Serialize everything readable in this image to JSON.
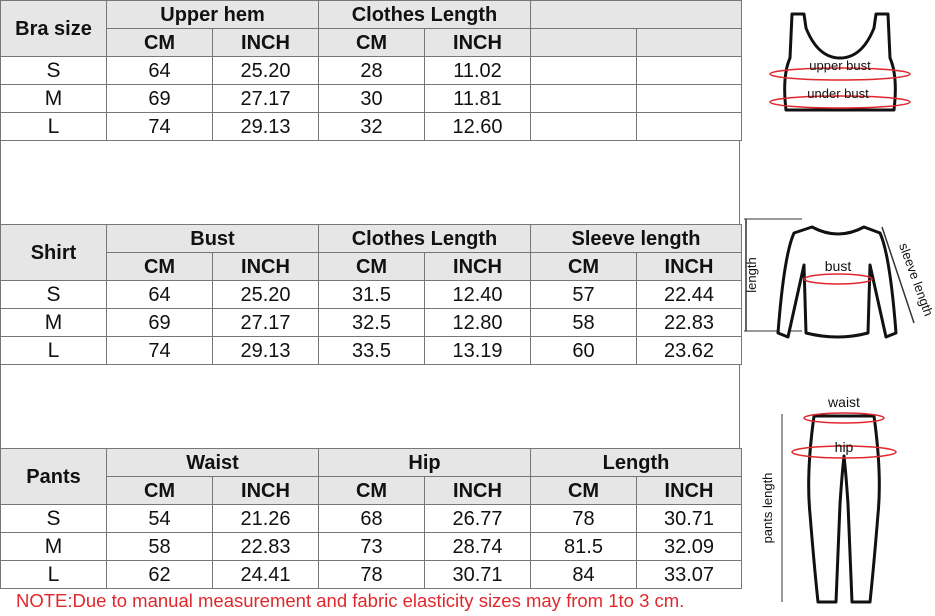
{
  "tables": [
    {
      "label": "Bra size",
      "groups": [
        "Upper hem",
        "Clothes Length",
        ""
      ],
      "units": [
        "CM",
        "INCH",
        "CM",
        "INCH",
        "",
        ""
      ],
      "rows": [
        [
          "S",
          "64",
          "25.20",
          "28",
          "11.02",
          "",
          ""
        ],
        [
          "M",
          "69",
          "27.17",
          "30",
          "11.81",
          "",
          ""
        ],
        [
          "L",
          "74",
          "29.13",
          "32",
          "12.60",
          "",
          ""
        ]
      ]
    },
    {
      "label": "Shirt",
      "groups": [
        "Bust",
        "Clothes Length",
        "Sleeve length"
      ],
      "units": [
        "CM",
        "INCH",
        "CM",
        "INCH",
        "CM",
        "INCH"
      ],
      "rows": [
        [
          "S",
          "64",
          "25.20",
          "31.5",
          "12.40",
          "57",
          "22.44"
        ],
        [
          "M",
          "69",
          "27.17",
          "32.5",
          "12.80",
          "58",
          "22.83"
        ],
        [
          "L",
          "74",
          "29.13",
          "33.5",
          "13.19",
          "60",
          "23.62"
        ]
      ]
    },
    {
      "label": "Pants",
      "groups": [
        "Waist",
        "Hip",
        "Length"
      ],
      "units": [
        "CM",
        "INCH",
        "CM",
        "INCH",
        "CM",
        "INCH"
      ],
      "rows": [
        [
          "S",
          "54",
          "21.26",
          "68",
          "26.77",
          "78",
          "30.71"
        ],
        [
          "M",
          "58",
          "22.83",
          "73",
          "28.74",
          "81.5",
          "32.09"
        ],
        [
          "L",
          "62",
          "24.41",
          "78",
          "30.71",
          "84",
          "33.07"
        ]
      ]
    }
  ],
  "note": "NOTE:Due to manual measurement and fabric elasticity sizes may from 1to 3 cm.",
  "diagrams": {
    "bra": {
      "upper": "upper bust",
      "under": "under bust"
    },
    "shirt": {
      "length": "length",
      "bust": "bust",
      "sleeve": "sleeve length"
    },
    "pants": {
      "waist": "waist",
      "hip": "hip",
      "length": "pants length"
    }
  },
  "colors": {
    "header_bg": "#e6e6e6",
    "note": "#e0282c",
    "measure_line": "#e0282c"
  }
}
